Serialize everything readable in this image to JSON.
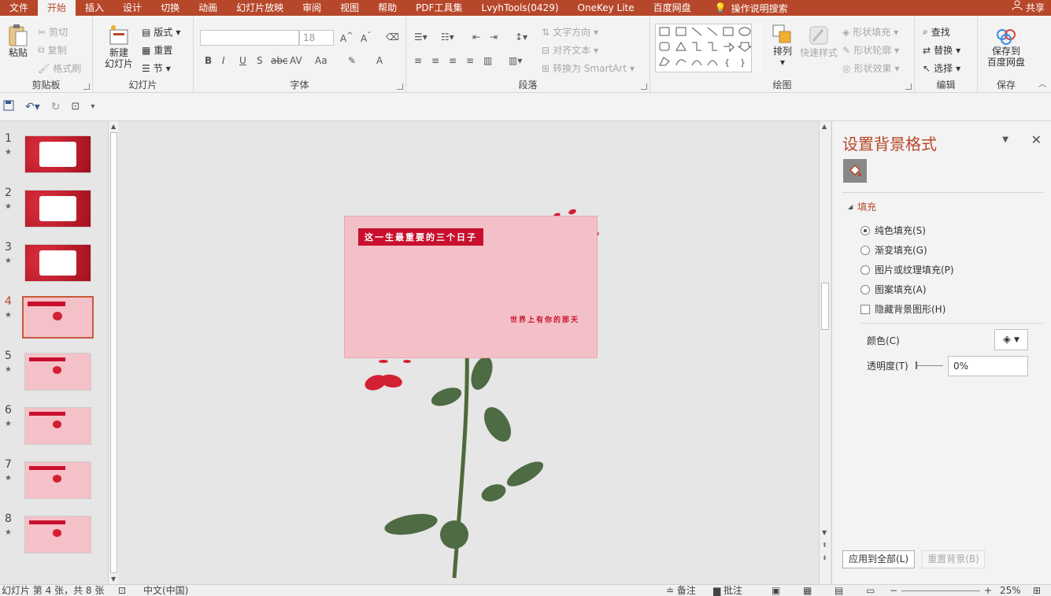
{
  "menu": {
    "items": [
      "文件",
      "开始",
      "插入",
      "设计",
      "切换",
      "动画",
      "幻灯片放映",
      "审阅",
      "视图",
      "帮助",
      "PDF工具集",
      "LvyhTools(0429)",
      "OneKey Lite",
      "百度网盘"
    ],
    "active_index": 1,
    "tell_me": "操作说明搜索",
    "share": "共享"
  },
  "ribbon": {
    "clipboard": {
      "label": "剪贴板",
      "paste": "粘贴",
      "cut": "剪切",
      "copy": "复制",
      "format_painter": "格式刷"
    },
    "slides": {
      "label": "幻灯片",
      "new_slide_line1": "新建",
      "new_slide_line2": "幻灯片",
      "layout": "版式",
      "reset": "重置",
      "section": "节"
    },
    "font": {
      "label": "字体",
      "size": "18",
      "bold": "B",
      "italic": "I",
      "underline": "U",
      "shadow": "S",
      "strike": "abc",
      "spacing": "AV",
      "case": "Aa",
      "color": "A"
    },
    "paragraph": {
      "label": "段落",
      "text_direction": "文字方向",
      "align_text": "对齐文本",
      "smartart": "转换为 SmartArt"
    },
    "drawing": {
      "label": "绘图",
      "arrange": "排列",
      "quick_styles": "快速样式",
      "shape_fill": "形状填充",
      "shape_outline": "形状轮廓",
      "shape_effects": "形状效果"
    },
    "editing": {
      "label": "编辑",
      "find": "查找",
      "replace": "替换",
      "select": "选择"
    },
    "save": {
      "label": "保存",
      "save_to_line1": "保存到",
      "save_to_line2": "百度网盘"
    }
  },
  "slides_panel": {
    "thumbnails": [
      {
        "num": "1",
        "style": "red"
      },
      {
        "num": "2",
        "style": "red"
      },
      {
        "num": "3",
        "style": "red"
      },
      {
        "num": "4",
        "style": "pink"
      },
      {
        "num": "5",
        "style": "pink"
      },
      {
        "num": "6",
        "style": "pink"
      },
      {
        "num": "7",
        "style": "pink"
      },
      {
        "num": "8",
        "style": "pink"
      }
    ],
    "selected": "4"
  },
  "slide": {
    "title": "这一生最重要的三个日子",
    "subtitle": "世界上有你的那天"
  },
  "format_pane": {
    "title": "设置背景格式",
    "section": "填充",
    "options": [
      "纯色填充(S)",
      "渐变填充(G)",
      "图片或纹理填充(P)",
      "图案填充(A)"
    ],
    "selected_option": 0,
    "hide_graphics": "隐藏背景图形(H)",
    "color_label": "颜色(C)",
    "transparency_label": "透明度(T)",
    "transparency_value": "0%",
    "apply_all": "应用到全部(L)",
    "reset_bg": "重置背景(B)"
  },
  "statusbar": {
    "slide_info": "幻灯片 第 4 张，共 8 张",
    "language": "中文(中国)",
    "notes": "备注",
    "comments": "批注",
    "zoom": "25%"
  },
  "colors": {
    "accent": "#b7472a",
    "slide_bg": "#f4c0c7",
    "title_bg": "#c8102e"
  }
}
